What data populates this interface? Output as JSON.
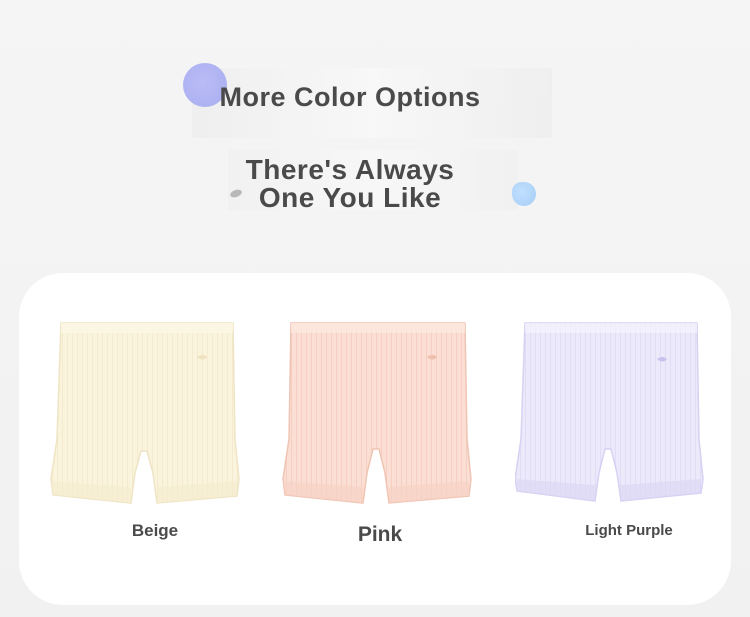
{
  "header": {
    "title": "More Color Options",
    "subtitle_line1": "There's Always",
    "subtitle_line2": "One You Like"
  },
  "products": [
    {
      "label": "Beige",
      "color": "#fbf4dc",
      "shade": "#f2e8c6",
      "band": "#fdf8e6"
    },
    {
      "label": "Pink",
      "color": "#fbdfd4",
      "shade": "#f2cabb",
      "band": "#fde8df"
    },
    {
      "label": "Light Purple",
      "color": "#ece9fb",
      "shade": "#d9d4f3",
      "band": "#f3f1fd"
    }
  ],
  "colors": {
    "background": "#f3f3f3",
    "card": "#ffffff",
    "text": "#4a4a4a",
    "accent_circle": "#b0b3f2",
    "accent_blob": "#b3d6fa"
  }
}
